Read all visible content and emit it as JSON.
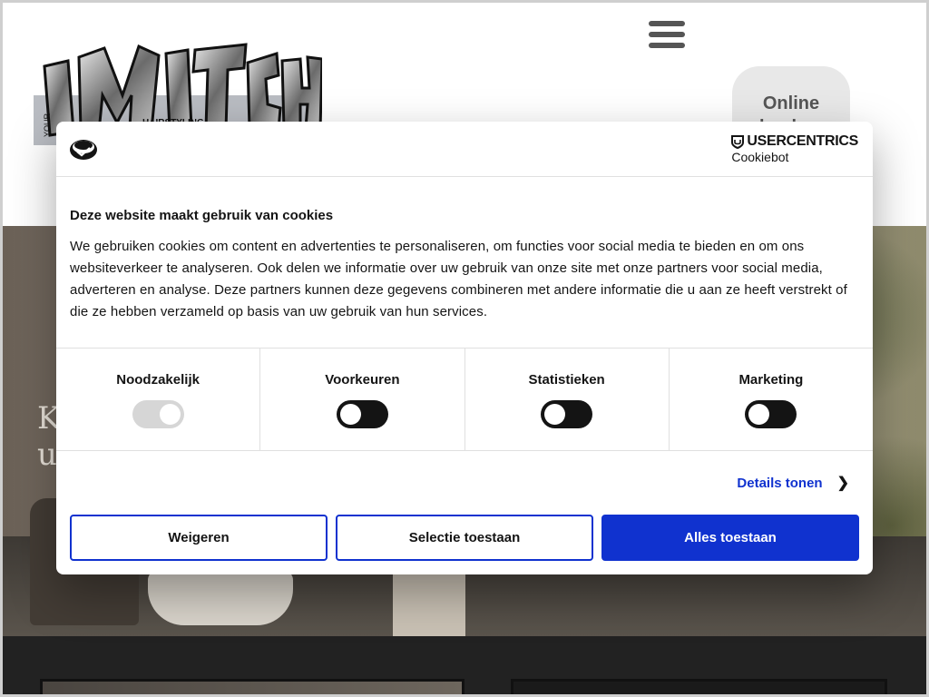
{
  "header": {
    "logo_text": "MITCH",
    "logo_small": "YOUR",
    "logo_sub": "HAIRSTYLING",
    "book_label": "Online boeken"
  },
  "hero": {
    "text_line1": "K",
    "text_line2": "u"
  },
  "cookie": {
    "brand_name": "USERCENTRICS",
    "brand_sub": "Cookiebot",
    "title": "Deze website maakt gebruik van cookies",
    "body": "We gebruiken cookies om content en advertenties te personaliseren, om functies voor social media te bieden en om ons websiteverkeer te analyseren. Ook delen we informatie over uw gebruik van onze site met onze partners voor social media, adverteren en analyse. Deze partners kunnen deze gegevens combineren met andere informatie die u aan ze heeft verstrekt of die ze hebben verzameld op basis van uw gebruik van hun services.",
    "categories": [
      {
        "label": "Noodzakelijk",
        "state": "on-disabled"
      },
      {
        "label": "Voorkeuren",
        "state": "off"
      },
      {
        "label": "Statistieken",
        "state": "off"
      },
      {
        "label": "Marketing",
        "state": "off"
      }
    ],
    "details_label": "Details tonen",
    "buttons": {
      "reject": "Weigeren",
      "selection": "Selectie toestaan",
      "accept_all": "Alles toestaan"
    },
    "colors": {
      "accent": "#1032cf",
      "text": "#141414"
    }
  }
}
